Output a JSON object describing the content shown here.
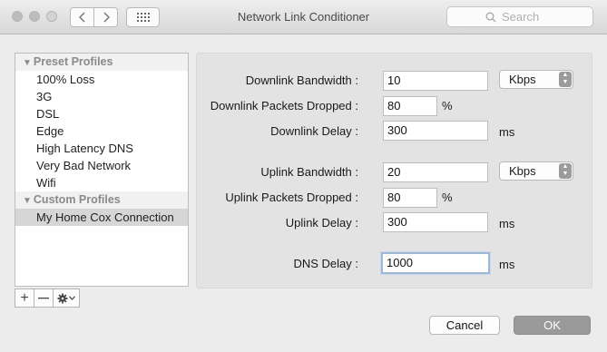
{
  "window": {
    "title": "Network Link Conditioner",
    "search_placeholder": "Search"
  },
  "sidebar": {
    "preset_header": "Preset Profiles",
    "preset_items": [
      "100% Loss",
      "3G",
      "DSL",
      "Edge",
      "High Latency DNS",
      "Very Bad Network",
      "Wifi"
    ],
    "custom_header": "Custom Profiles",
    "custom_items": [
      "My Home Cox Connection"
    ],
    "selected_item": "My Home Cox Connection",
    "tools": {
      "add": "+",
      "remove": "—"
    }
  },
  "form": {
    "downlink_bandwidth_label": "Downlink Bandwidth :",
    "downlink_bandwidth_value": "10",
    "downlink_bandwidth_unit": "Kbps",
    "downlink_dropped_label": "Downlink Packets Dropped :",
    "downlink_dropped_value": "80",
    "downlink_dropped_unit": "%",
    "downlink_delay_label": "Downlink Delay :",
    "downlink_delay_value": "300",
    "downlink_delay_unit": "ms",
    "uplink_bandwidth_label": "Uplink Bandwidth :",
    "uplink_bandwidth_value": "20",
    "uplink_bandwidth_unit": "Kbps",
    "uplink_dropped_label": "Uplink Packets Dropped :",
    "uplink_dropped_value": "80",
    "uplink_dropped_unit": "%",
    "uplink_delay_label": "Uplink Delay :",
    "uplink_delay_value": "300",
    "uplink_delay_unit": "ms",
    "dns_delay_label": "DNS Delay :",
    "dns_delay_value": "1000",
    "dns_delay_unit": "ms"
  },
  "buttons": {
    "cancel": "Cancel",
    "ok": "OK"
  },
  "colors": {
    "ok_button": "#9a9a9a",
    "selection": "#d6d6d6",
    "focus_ring": "#9eb8d6"
  }
}
